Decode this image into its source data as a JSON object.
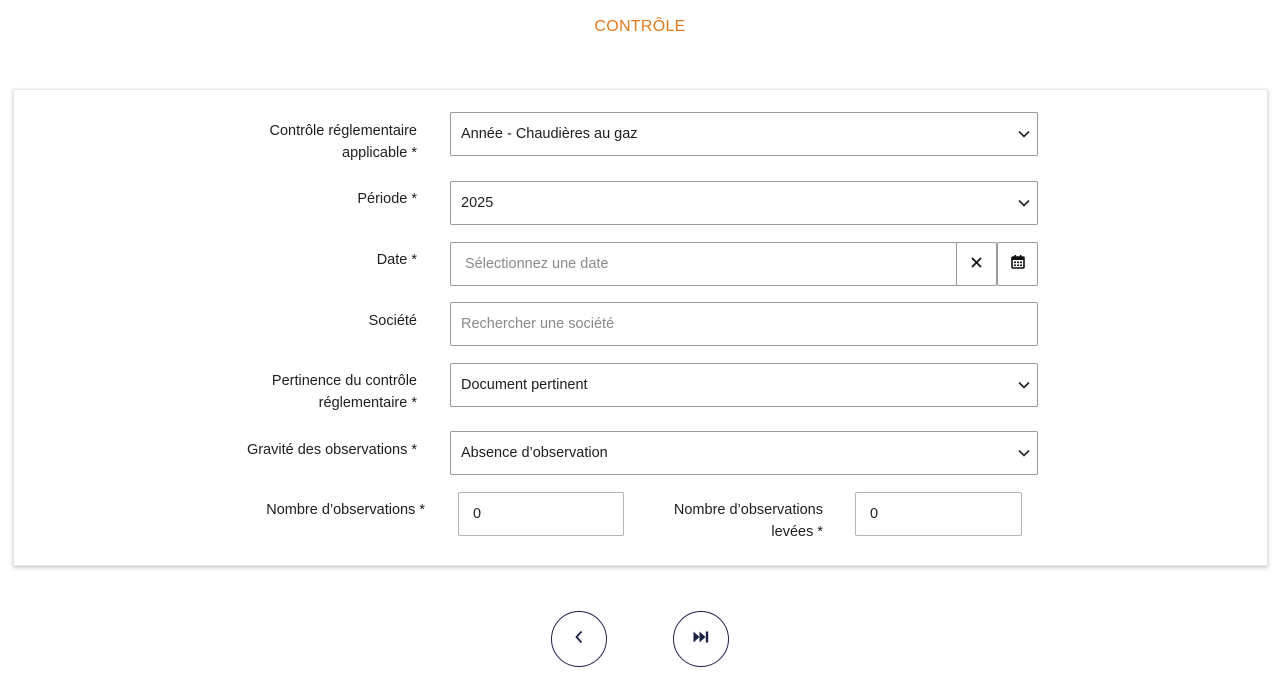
{
  "page": {
    "title": "CONTRÔLE"
  },
  "form": {
    "controle": {
      "label_line1": "Contrôle réglementaire",
      "label_line2": "applicable *",
      "value": "Année - Chaudières au gaz"
    },
    "periode": {
      "label": "Période *",
      "value": "2025"
    },
    "date": {
      "label": "Date *",
      "placeholder": "Sélectionnez une date",
      "clear_icon": "close-icon",
      "calendar_icon": "calendar-icon"
    },
    "societe": {
      "label": "Société",
      "placeholder": "Rechercher une société"
    },
    "pertinence": {
      "label_line1": "Pertinence du contrôle",
      "label_line2": "réglementaire *",
      "value": "Document pertinent"
    },
    "gravite": {
      "label": "Gravité des observations *",
      "value": "Absence d’observation"
    },
    "nombre_observations": {
      "label": "Nombre d’observations *",
      "value": "0"
    },
    "nombre_levees": {
      "label_line1": "Nombre d’observations",
      "label_line2": "levées *",
      "value": "0"
    }
  },
  "navigation": {
    "previous_icon": "chevron-left-icon",
    "skip_icon": "skip-forward-icon"
  },
  "colors": {
    "accent": "#e07a1f",
    "nav_border": "#1c2148",
    "field_border": "#9a9a9a"
  }
}
